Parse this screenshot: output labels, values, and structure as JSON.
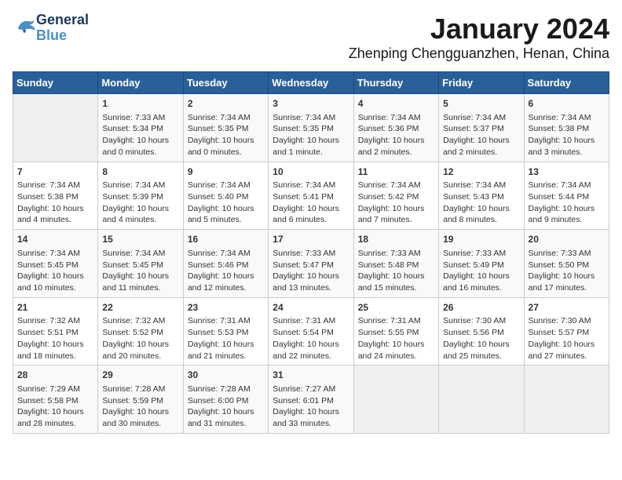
{
  "logo": {
    "line1": "General",
    "line2": "Blue"
  },
  "header": {
    "month_year": "January 2024",
    "location": "Zhenping Chengguanzhen, Henan, China"
  },
  "weekdays": [
    "Sunday",
    "Monday",
    "Tuesday",
    "Wednesday",
    "Thursday",
    "Friday",
    "Saturday"
  ],
  "weeks": [
    [
      {
        "day": "",
        "info": ""
      },
      {
        "day": "1",
        "info": "Sunrise: 7:33 AM\nSunset: 5:34 PM\nDaylight: 10 hours\nand 0 minutes."
      },
      {
        "day": "2",
        "info": "Sunrise: 7:34 AM\nSunset: 5:35 PM\nDaylight: 10 hours\nand 0 minutes."
      },
      {
        "day": "3",
        "info": "Sunrise: 7:34 AM\nSunset: 5:35 PM\nDaylight: 10 hours\nand 1 minute."
      },
      {
        "day": "4",
        "info": "Sunrise: 7:34 AM\nSunset: 5:36 PM\nDaylight: 10 hours\nand 2 minutes."
      },
      {
        "day": "5",
        "info": "Sunrise: 7:34 AM\nSunset: 5:37 PM\nDaylight: 10 hours\nand 2 minutes."
      },
      {
        "day": "6",
        "info": "Sunrise: 7:34 AM\nSunset: 5:38 PM\nDaylight: 10 hours\nand 3 minutes."
      }
    ],
    [
      {
        "day": "7",
        "info": "Sunrise: 7:34 AM\nSunset: 5:38 PM\nDaylight: 10 hours\nand 4 minutes."
      },
      {
        "day": "8",
        "info": "Sunrise: 7:34 AM\nSunset: 5:39 PM\nDaylight: 10 hours\nand 4 minutes."
      },
      {
        "day": "9",
        "info": "Sunrise: 7:34 AM\nSunset: 5:40 PM\nDaylight: 10 hours\nand 5 minutes."
      },
      {
        "day": "10",
        "info": "Sunrise: 7:34 AM\nSunset: 5:41 PM\nDaylight: 10 hours\nand 6 minutes."
      },
      {
        "day": "11",
        "info": "Sunrise: 7:34 AM\nSunset: 5:42 PM\nDaylight: 10 hours\nand 7 minutes."
      },
      {
        "day": "12",
        "info": "Sunrise: 7:34 AM\nSunset: 5:43 PM\nDaylight: 10 hours\nand 8 minutes."
      },
      {
        "day": "13",
        "info": "Sunrise: 7:34 AM\nSunset: 5:44 PM\nDaylight: 10 hours\nand 9 minutes."
      }
    ],
    [
      {
        "day": "14",
        "info": "Sunrise: 7:34 AM\nSunset: 5:45 PM\nDaylight: 10 hours\nand 10 minutes."
      },
      {
        "day": "15",
        "info": "Sunrise: 7:34 AM\nSunset: 5:45 PM\nDaylight: 10 hours\nand 11 minutes."
      },
      {
        "day": "16",
        "info": "Sunrise: 7:34 AM\nSunset: 5:46 PM\nDaylight: 10 hours\nand 12 minutes."
      },
      {
        "day": "17",
        "info": "Sunrise: 7:33 AM\nSunset: 5:47 PM\nDaylight: 10 hours\nand 13 minutes."
      },
      {
        "day": "18",
        "info": "Sunrise: 7:33 AM\nSunset: 5:48 PM\nDaylight: 10 hours\nand 15 minutes."
      },
      {
        "day": "19",
        "info": "Sunrise: 7:33 AM\nSunset: 5:49 PM\nDaylight: 10 hours\nand 16 minutes."
      },
      {
        "day": "20",
        "info": "Sunrise: 7:33 AM\nSunset: 5:50 PM\nDaylight: 10 hours\nand 17 minutes."
      }
    ],
    [
      {
        "day": "21",
        "info": "Sunrise: 7:32 AM\nSunset: 5:51 PM\nDaylight: 10 hours\nand 18 minutes."
      },
      {
        "day": "22",
        "info": "Sunrise: 7:32 AM\nSunset: 5:52 PM\nDaylight: 10 hours\nand 20 minutes."
      },
      {
        "day": "23",
        "info": "Sunrise: 7:31 AM\nSunset: 5:53 PM\nDaylight: 10 hours\nand 21 minutes."
      },
      {
        "day": "24",
        "info": "Sunrise: 7:31 AM\nSunset: 5:54 PM\nDaylight: 10 hours\nand 22 minutes."
      },
      {
        "day": "25",
        "info": "Sunrise: 7:31 AM\nSunset: 5:55 PM\nDaylight: 10 hours\nand 24 minutes."
      },
      {
        "day": "26",
        "info": "Sunrise: 7:30 AM\nSunset: 5:56 PM\nDaylight: 10 hours\nand 25 minutes."
      },
      {
        "day": "27",
        "info": "Sunrise: 7:30 AM\nSunset: 5:57 PM\nDaylight: 10 hours\nand 27 minutes."
      }
    ],
    [
      {
        "day": "28",
        "info": "Sunrise: 7:29 AM\nSunset: 5:58 PM\nDaylight: 10 hours\nand 28 minutes."
      },
      {
        "day": "29",
        "info": "Sunrise: 7:28 AM\nSunset: 5:59 PM\nDaylight: 10 hours\nand 30 minutes."
      },
      {
        "day": "30",
        "info": "Sunrise: 7:28 AM\nSunset: 6:00 PM\nDaylight: 10 hours\nand 31 minutes."
      },
      {
        "day": "31",
        "info": "Sunrise: 7:27 AM\nSunset: 6:01 PM\nDaylight: 10 hours\nand 33 minutes."
      },
      {
        "day": "",
        "info": ""
      },
      {
        "day": "",
        "info": ""
      },
      {
        "day": "",
        "info": ""
      }
    ]
  ]
}
